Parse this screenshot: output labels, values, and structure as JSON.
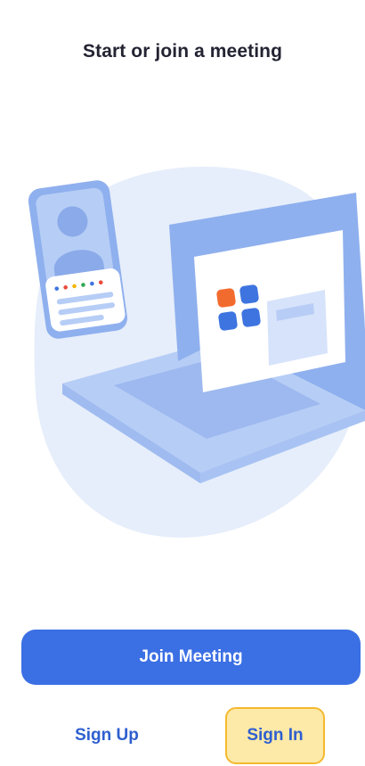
{
  "header": {
    "title": "Start or join a meeting"
  },
  "actions": {
    "join_label": "Join Meeting",
    "signup_label": "Sign Up",
    "signin_label": "Sign In"
  },
  "colors": {
    "primary_button": "#3b6fe4",
    "link_text": "#2e5fcf",
    "highlight_fill": "#fde9a8",
    "highlight_border": "#f5b92e",
    "illustration_bg": "#e8f0fc"
  },
  "icons": {
    "illustration": "phone-and-laptop-illustration"
  }
}
